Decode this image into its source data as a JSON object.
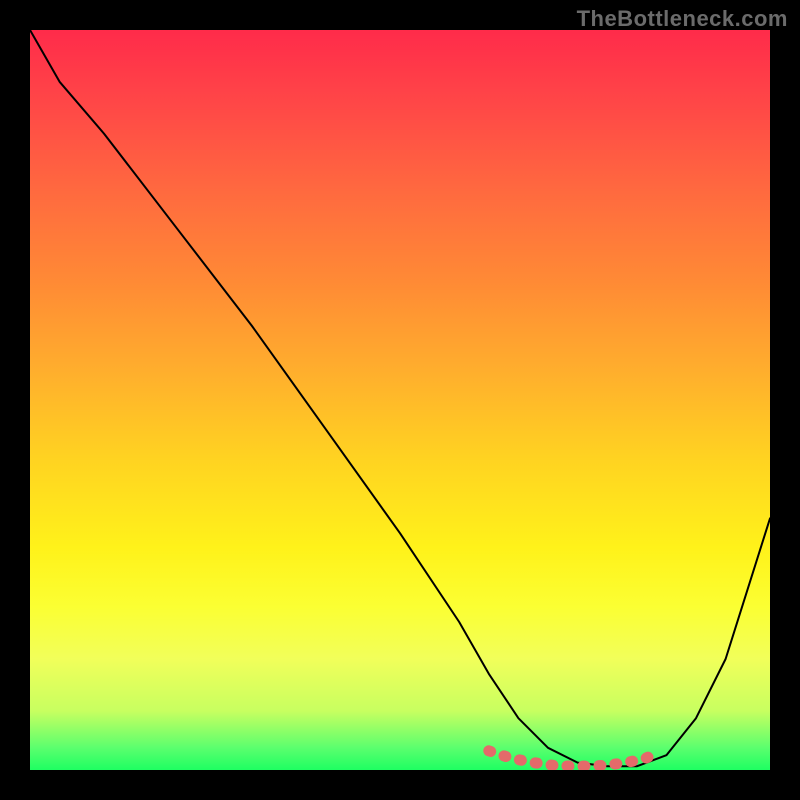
{
  "watermark": "TheBottleneck.com",
  "chart_data": {
    "type": "line",
    "title": "",
    "xlabel": "",
    "ylabel": "",
    "xlim": [
      0,
      100
    ],
    "ylim": [
      0,
      100
    ],
    "series": [
      {
        "name": "bottleneck-curve",
        "x": [
          0,
          4,
          10,
          20,
          30,
          40,
          50,
          58,
          62,
          66,
          70,
          74,
          78,
          82,
          86,
          90,
          94,
          100
        ],
        "y": [
          100,
          93,
          86,
          73,
          60,
          46,
          32,
          20,
          13,
          7,
          3,
          1,
          0.5,
          0.5,
          2,
          7,
          15,
          34
        ]
      }
    ],
    "highlight": {
      "name": "optimal-range",
      "x": [
        62,
        65,
        68,
        71,
        74,
        77,
        80,
        83,
        85
      ],
      "y": [
        2.6,
        1.6,
        1.0,
        0.6,
        0.5,
        0.6,
        0.9,
        1.5,
        2.4
      ]
    },
    "colors": {
      "curve": "#000000",
      "highlight": "#e46a6a",
      "background_top": "#ff2b4a",
      "background_bottom": "#1eff62"
    }
  }
}
